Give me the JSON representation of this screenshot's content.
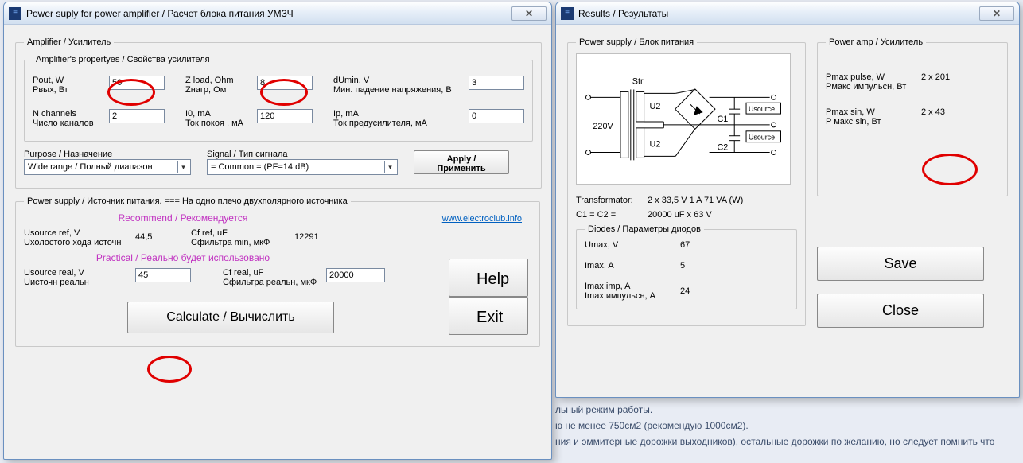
{
  "bg": {
    "l1": "льный режим работы.",
    "l2": "ю не менее 750см2 (рекомендую 1000см2).",
    "l3": "ния и эммитерные дорожки выходников), остальные дорожки по желанию, но следует помнить что"
  },
  "win1": {
    "title": "Power suply for power amplifier / Расчет блока питания УМЗЧ",
    "groups": {
      "amp": "Amplifier / Усилитель",
      "props": "Amplifier's propertyes / Свойства усилителя",
      "ps": "Power supply / Источник питания. ===  На одно плечо двухполярного источника"
    },
    "labels": {
      "pout": "Pout, W",
      "pout_ru": "Pвых, Вт",
      "zload": "Z load, Ohm",
      "zload_ru": "Zнагр, Ом",
      "dumin": "dUmin, V",
      "dumin_ru": "Мин. падение напряжения, В",
      "nch": "N channels",
      "nch_ru": "Число каналов",
      "i0": "I0, mA",
      "i0_ru": "Ток покоя , мА",
      "ip": "Ip, mA",
      "ip_ru": "Ток предусилителя, мА",
      "purpose": "Purpose / Назначение",
      "signal": "Signal / Тип сигнала",
      "apply": "Apply / Применить",
      "recommend": "Recommend / Рекомендуется",
      "usrcref": "Usource ref, V",
      "usrcref_ru": "Uхолостого хода источн",
      "cfref": "Cf ref, uF",
      "cfref_ru": "Cфильтра min, мкФ",
      "practical": "Practical / Реально будет использовано",
      "usrcreal": "Usource real, V",
      "usrcreal_ru": "Uисточн реальн",
      "cfreal": "Cf real, uF",
      "cfreal_ru": "Cфильтра реальн, мкФ",
      "calc": "Calculate / Вычислить",
      "help": "Help",
      "exit": "Exit",
      "link": "www.electroclub.info"
    },
    "values": {
      "pout": "50",
      "zload": "8",
      "dumin": "3",
      "nch": "2",
      "i0": "120",
      "ip": "0",
      "purpose": "Wide range / Полный диапазон",
      "signal": "= Common =    (PF=14 dB)",
      "usrcref": "44,5",
      "cfref": "12291",
      "usrcreal": "45",
      "cfreal": "20000"
    }
  },
  "win2": {
    "title": "Results / Результаты",
    "groups": {
      "ps": "Power supply / Блок питания",
      "diodes": "Diodes / Параметры диодов",
      "amp": "Power amp / Усилитель"
    },
    "schem": {
      "str": "Str",
      "v220": "220V",
      "u2a": "U2",
      "u2b": "U2",
      "c1": "C1",
      "c2": "C2",
      "usrc": "Usource"
    },
    "labels": {
      "trans": "Transformator:",
      "c1c2": "C1 = C2 =",
      "umax": "Umax, V",
      "imax": "Imax, A",
      "imaximp": "Imax imp, A",
      "imaximp_ru": "Imax импульсн, А",
      "pmaxpulse": "Pmax pulse, W",
      "pmaxpulse_ru": "Рмакс импульсн, Вт",
      "pmaxsin": "Pmax sin, W",
      "pmaxsin_ru": "P макс sin, Вт",
      "save": "Save",
      "close": "Close"
    },
    "values": {
      "trans": "2 x 33,5 V   1 A    71  VA (W)",
      "c1c2": "20000 uF   x  63 V",
      "umax": "67",
      "imax": "5",
      "imaximp": "24",
      "pmaxpulse": "2 x 201",
      "pmaxsin": "2 x 43"
    }
  }
}
